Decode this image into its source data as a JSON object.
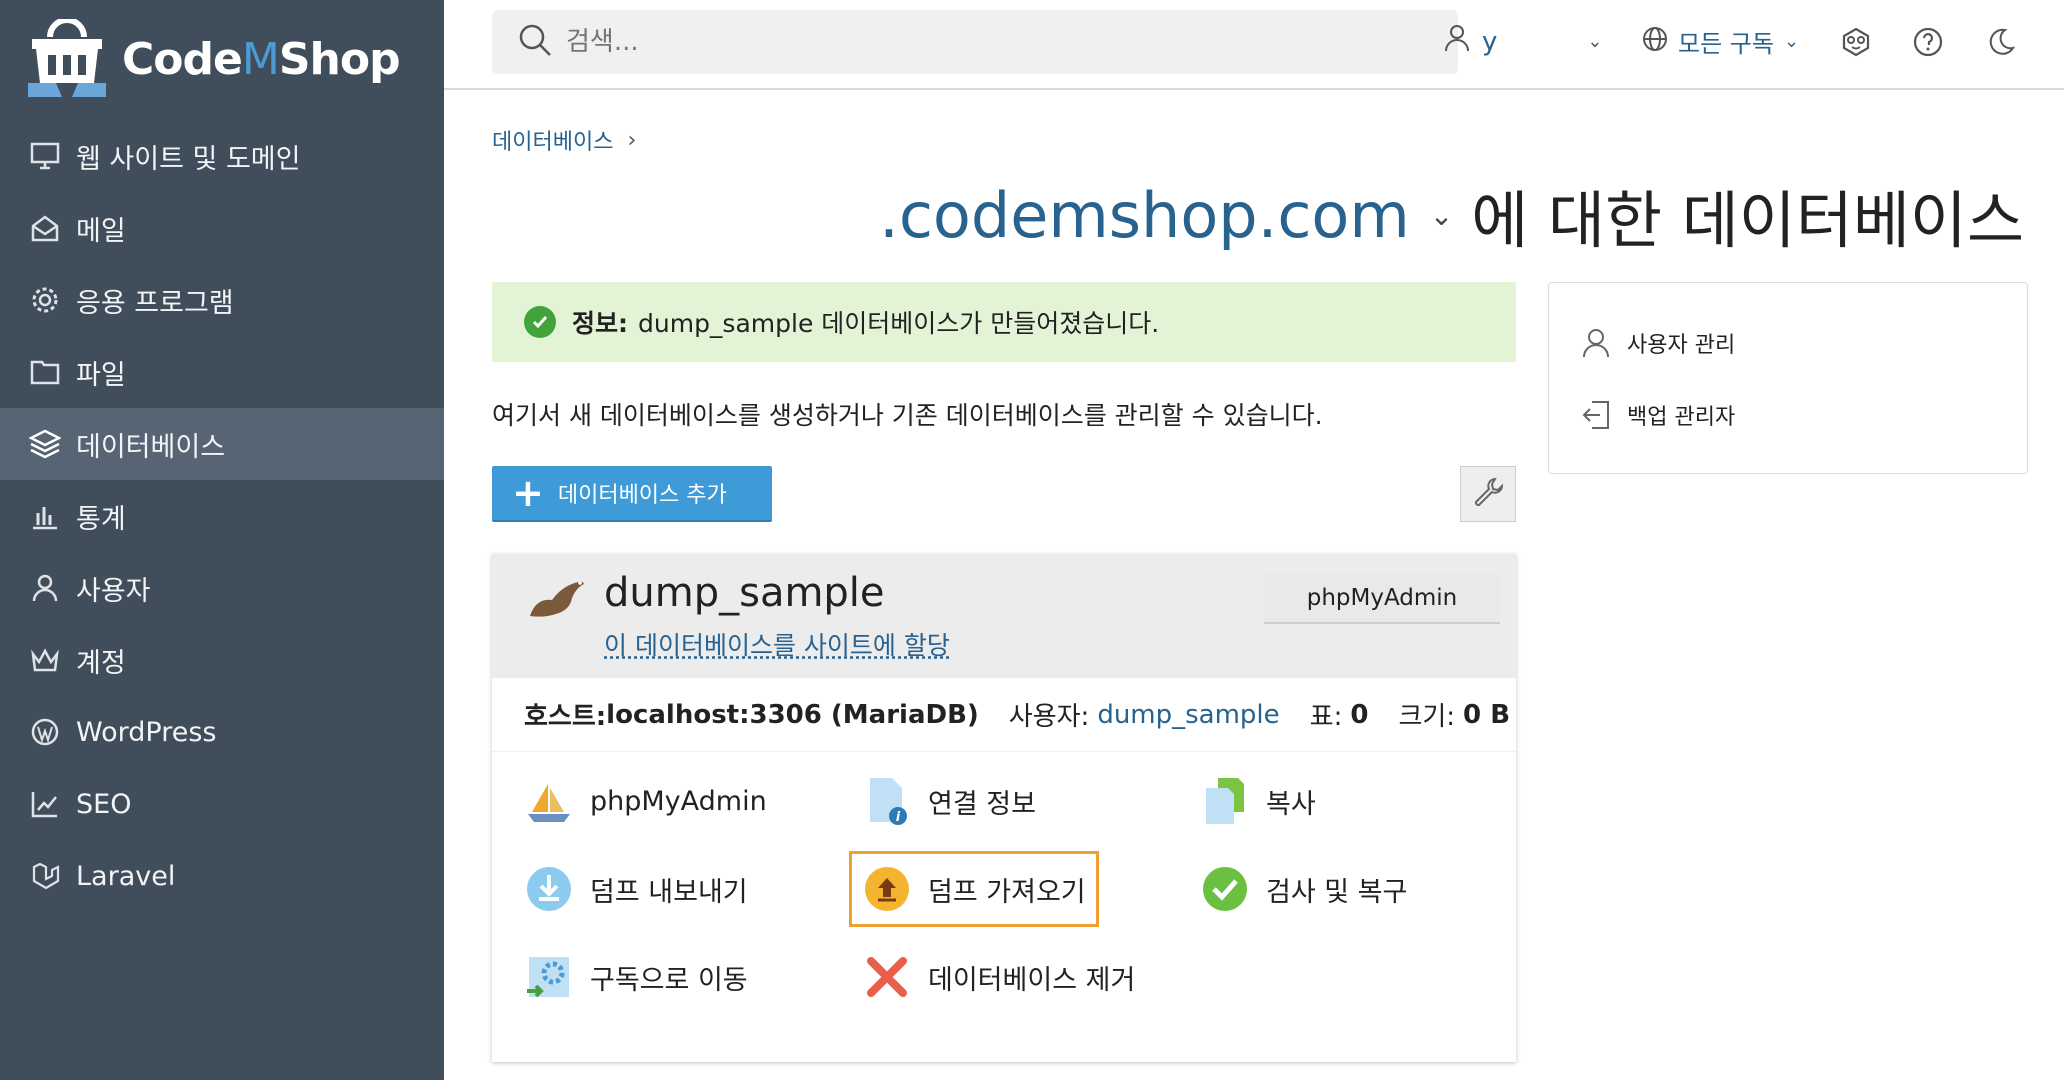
{
  "brand": {
    "logo_text_a": "Code",
    "logo_text_m": "M",
    "logo_text_b": "Shop"
  },
  "sidebar": {
    "items": [
      {
        "label": "웹 사이트 및 도메인",
        "icon": "monitor-icon"
      },
      {
        "label": "메일",
        "icon": "mail-icon"
      },
      {
        "label": "응용 프로그램",
        "icon": "gear-icon"
      },
      {
        "label": "파일",
        "icon": "folder-icon"
      },
      {
        "label": "데이터베이스",
        "icon": "layers-icon",
        "active": true
      },
      {
        "label": "통계",
        "icon": "bar-chart-icon"
      },
      {
        "label": "사용자",
        "icon": "user-icon"
      },
      {
        "label": "계정",
        "icon": "crown-icon"
      },
      {
        "label": "WordPress",
        "icon": "wordpress-icon"
      },
      {
        "label": "SEO",
        "icon": "seo-chart-icon"
      },
      {
        "label": "Laravel",
        "icon": "laravel-icon"
      }
    ]
  },
  "topbar": {
    "search_placeholder": "검색...",
    "user_label": "y",
    "subscription_label": "모든 구독"
  },
  "breadcrumb": {
    "item": "데이터베이스"
  },
  "title": {
    "domain": ".codemshop.com",
    "suffix": "에 대한 데이터베이스"
  },
  "info": {
    "label": "정보:",
    "message": "dump_sample 데이터베이스가 만들어졌습니다."
  },
  "description": "여기서 새 데이터베이스를 생성하거나 기존 데이터베이스를 관리할 수 있습니다.",
  "add_button": "데이터베이스 추가",
  "database": {
    "name": "dump_sample",
    "assign_link": "이 데이터베이스를 사이트에 할당",
    "phpmyadmin_button": "phpMyAdmin",
    "host_label": "호스트:",
    "host_value": "localhost:3306 (MariaDB)",
    "user_label": "사용자:",
    "user_value": "dump_sample",
    "tables_label": "표:",
    "tables_value": "0",
    "size_label": "크기:",
    "size_value": "0 B",
    "actions": {
      "phpmyadmin": "phpMyAdmin",
      "connection_info": "연결 정보",
      "copy": "복사",
      "export_dump": "덤프 내보내기",
      "import_dump": "덤프 가져오기",
      "check_repair": "검사 및 복구",
      "move_subscription": "구독으로 이동",
      "remove": "데이터베이스 제거"
    }
  },
  "side_panel": {
    "user_management": "사용자 관리",
    "backup_manager": "백업 관리자"
  },
  "colors": {
    "sidebar_bg": "#404d5b",
    "sidebar_active": "#566474",
    "link": "#28628f",
    "primary_button": "#3f9bd8",
    "info_bg": "#e3f4d6",
    "highlight": "#f0a030"
  }
}
